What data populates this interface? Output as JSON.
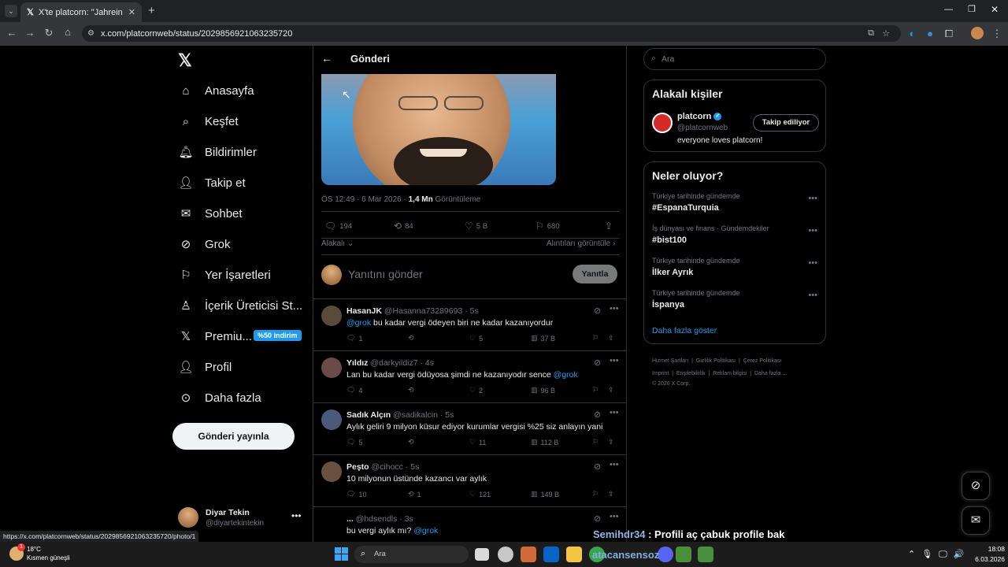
{
  "browser": {
    "tab_title": "X'te platcorn: \"Jahrein ödediği ...",
    "url": "x.com/platcornweb/status/2029856921063235720",
    "status_url": "https://x.com/platcornweb/status/2029856921063235720/photo/1"
  },
  "nav": {
    "items": [
      {
        "label": "Anasayfa",
        "icon": "home-icon"
      },
      {
        "label": "Keşfet",
        "icon": "search-icon"
      },
      {
        "label": "Bildirimler",
        "icon": "bell-icon"
      },
      {
        "label": "Takip et",
        "icon": "person-add-icon"
      },
      {
        "label": "Sohbet",
        "icon": "mail-icon"
      },
      {
        "label": "Grok",
        "icon": "grok-icon"
      },
      {
        "label": "Yer İşaretleri",
        "icon": "bookmark-icon"
      },
      {
        "label": "İçerik Üreticisi St...",
        "icon": "creator-icon"
      },
      {
        "label": "Premiu...",
        "icon": "x-icon"
      },
      {
        "label": "Profil",
        "icon": "person-icon"
      },
      {
        "label": "Daha fazla",
        "icon": "more-circle-icon"
      }
    ],
    "premium_badge": "%50 indirim",
    "post_button": "Gönderi yayınla",
    "account_name": "Diyar Tekin",
    "account_handle": "@diyartekintekin"
  },
  "post": {
    "header_title": "Gönderi",
    "meta_time": "ÖS 12:49 · 6 Mar 2026 · ",
    "views_count": "1,4 Mn",
    "views_label": " Görüntüleme",
    "replies": "194",
    "reposts": "84",
    "likes": "5 B",
    "bookmarks": "680",
    "relevant_label": "Alakalı",
    "quotes_label": "Alıntıları görüntüle",
    "reply_placeholder": "Yanıtını gönder",
    "reply_button": "Yanıtla"
  },
  "replies": [
    {
      "name": "HasanJK",
      "handle": "@Hasanna73289693 · 5s",
      "mention": "@grok",
      "text": " bu kadar vergi ödeyen biri ne kadar kazanıyordur",
      "mention_pos": "start",
      "replies": "1",
      "reposts": "",
      "likes": "5",
      "views": "37 B",
      "avatar_color": "#5a4a3a"
    },
    {
      "name": "Yıldız",
      "handle": "@darkyildiz7 · 4s",
      "mention": "@grok",
      "text": "Lan bu kadar vergi ödüyosa şimdi ne kazanıyodır sence ",
      "mention_pos": "end",
      "replies": "4",
      "reposts": "",
      "likes": "2",
      "views": "96 B",
      "avatar_color": "#6b4a4a"
    },
    {
      "name": "Sadık Alçın",
      "handle": "@sadikalcin · 5s",
      "mention": "",
      "text": "Aylık geliri 9 milyon küsur ediyor kurumlar vergisi %25 siz anlayın yani",
      "mention_pos": "none",
      "replies": "5",
      "reposts": "",
      "likes": "11",
      "views": "112 B",
      "avatar_color": "#4a5a7a"
    },
    {
      "name": "Peşto",
      "handle": "@cihocc · 5s",
      "mention": "",
      "text": "10 milyonun üstünde kazancı var aylık",
      "mention_pos": "none",
      "replies": "10",
      "reposts": "1",
      "likes": "121",
      "views": "149 B",
      "avatar_color": "#6a5040"
    },
    {
      "name": "...",
      "handle": "@hdsendls · 3s",
      "mention": "@grok",
      "text": "bu vergi aylık mı? ",
      "mention_pos": "end",
      "replies": "",
      "reposts": "",
      "likes": "",
      "views": "",
      "avatar_color": "#000000"
    }
  ],
  "right": {
    "search_placeholder": "Ara",
    "people_title": "Alakalı kişiler",
    "person_name": "platcorn",
    "person_handle": "@platcornweb",
    "person_bio": "everyone loves platcorn!",
    "following_button": "Takip ediliyor",
    "trends_title": "Neler oluyor?",
    "trends": [
      {
        "category": "Türkiye tarihinde gündemde",
        "title": "#EspanaTurquia"
      },
      {
        "category": "İş dünyası ve finans · Gündemdekiler",
        "title": "#bist100"
      },
      {
        "category": "Türkiye tarihinde gündemde",
        "title": "İlker Ayrık"
      },
      {
        "category": "Türkiye tarihinde gündemde",
        "title": "İspanya"
      }
    ],
    "show_more": "Daha fazla göster",
    "footer_row1": [
      "Hizmet Şartları",
      "Gizlilik Politikası",
      "Çerez Politikası"
    ],
    "footer_row2": [
      "Imprint",
      "Erişilebilirlik",
      "Reklam bilgisi",
      "Daha fazla ..."
    ],
    "copyright": "© 2026 X Corp."
  },
  "overlay": {
    "chat_user": "Semihdr34",
    "chat_text": " : Profili aç çabuk profile bak",
    "stream_name": "atacansensoz"
  },
  "taskbar": {
    "temp": "18°C",
    "weather": "Kısmen güneşli",
    "search": "Ara",
    "time": "18:08",
    "date": "6.03.2026",
    "weather_badge": "1"
  },
  "colors": {
    "accent": "#1d9bf0",
    "border": "#2f3336",
    "muted": "#71767b"
  }
}
